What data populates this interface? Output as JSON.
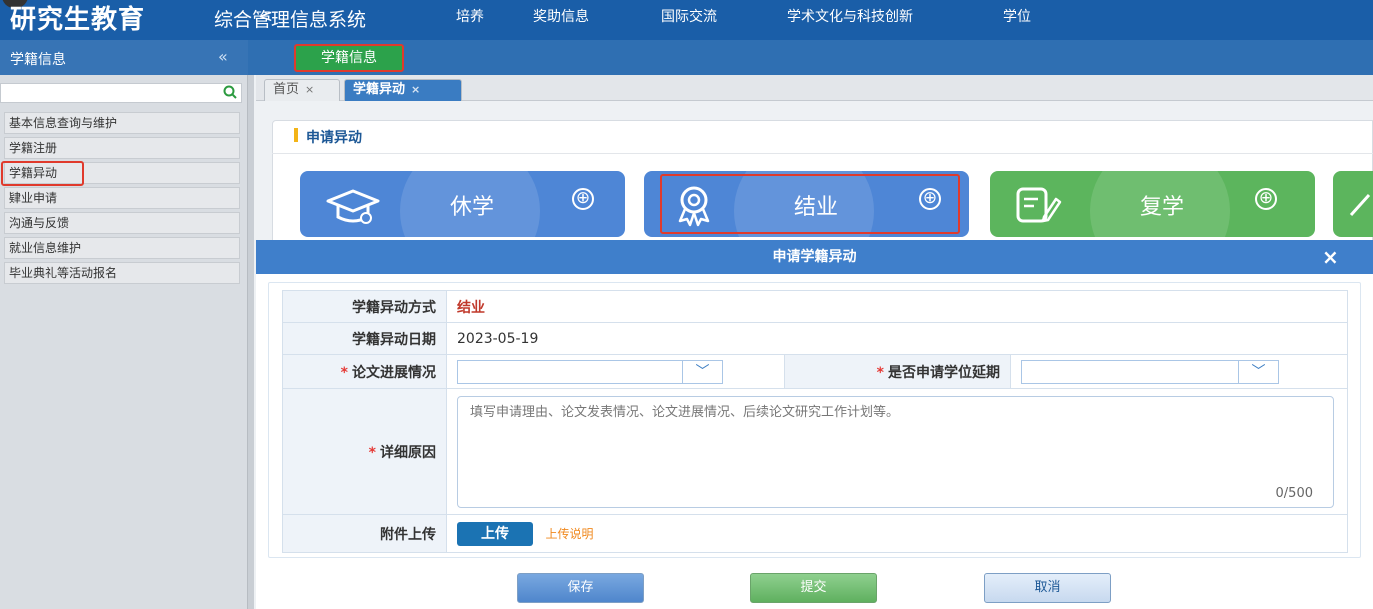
{
  "header": {
    "logo_text": "研究生教育",
    "system_name": "综合管理信息系统"
  },
  "sidebar": {
    "title": "学籍信息",
    "collapse_icon": "«",
    "search_icon": "search-icon",
    "items": [
      {
        "label": "基本信息查询与维护"
      },
      {
        "label": "学籍注册"
      },
      {
        "label": "学籍异动"
      },
      {
        "label": "肄业申请"
      },
      {
        "label": "沟通与反馈"
      },
      {
        "label": "就业信息维护"
      },
      {
        "label": "毕业典礼等活动报名"
      }
    ]
  },
  "nav": {
    "back": "<",
    "items": [
      {
        "label": "学籍信息"
      },
      {
        "label": "培养"
      },
      {
        "label": "奖助信息"
      },
      {
        "label": "国际交流"
      },
      {
        "label": "学术文化与科技创新"
      },
      {
        "label": "学位"
      }
    ]
  },
  "tabs": [
    {
      "label": "首页",
      "close": "×"
    },
    {
      "label": "学籍异动",
      "close": "×"
    }
  ],
  "panel": {
    "title": "申请异动",
    "cards": [
      {
        "label": "休学",
        "icon": "graduation-cap-icon",
        "color": "#4e86d6"
      },
      {
        "label": "结业",
        "icon": "award-ribbon-icon",
        "color": "#4e86d6"
      },
      {
        "label": "复学",
        "icon": "document-edit-icon",
        "color": "#5cb55d"
      }
    ],
    "plus": "⊕"
  },
  "modal": {
    "title": "申请学籍异动",
    "close": "×",
    "form": {
      "change_type_label": "学籍异动方式",
      "change_type_value": "结业",
      "change_date_label": "学籍异动日期",
      "change_date_value": "2023-05-19",
      "required_mark": "*",
      "thesis_label": "论文进展情况",
      "thesis_value": "",
      "deferral_label": "是否申请学位延期",
      "deferral_value": "",
      "reason_label": "详细原因",
      "reason_placeholder": "填写申请理由、论文发表情况、论文进展情况、后续论文研究工作计划等。",
      "reason_counter": "0/500",
      "attachment_label": "附件上传",
      "upload_button": "上传",
      "upload_help": "上传说明"
    },
    "buttons": {
      "save": "保存",
      "submit": "提交",
      "cancel": "取消"
    }
  },
  "colors": {
    "header": "#1a5ea8",
    "nav_active": "#2ca24b",
    "highlight": "#e03a2c",
    "modal_bar": "#3f7fcb"
  }
}
